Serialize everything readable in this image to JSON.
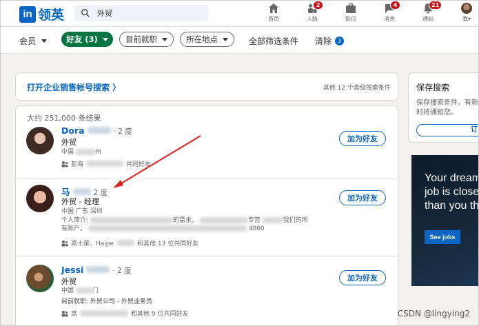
{
  "brand": {
    "logo_mark": "in",
    "name": "领英"
  },
  "search": {
    "value": "外贸"
  },
  "nav": [
    {
      "label": "首页",
      "icon": "home-icon",
      "badge": ""
    },
    {
      "label": "人脉",
      "icon": "network-icon",
      "badge": "2"
    },
    {
      "label": "职位",
      "icon": "jobs-icon",
      "badge": ""
    },
    {
      "label": "消息",
      "icon": "messaging-icon",
      "badge": "4"
    },
    {
      "label": "通知",
      "icon": "notifications-icon",
      "badge": "21"
    },
    {
      "label": "我",
      "icon": "me-avatar",
      "badge": ""
    }
  ],
  "filters": {
    "member": "会员",
    "friends": "好友 (3)",
    "company": "目前就职",
    "location": "所在地点",
    "all": "全部筛选条件",
    "clear": "清除",
    "clear_count": "3"
  },
  "sales": {
    "link": "打开企业销售帐号搜索 〉",
    "other": "其他 12 个高级搜索条件"
  },
  "results": {
    "count": "大约 251,000 条结果",
    "people": [
      {
        "name": "Dora",
        "degree": "· 2 度",
        "title": "外贸",
        "location_prefix": "中国",
        "location_suffix": "州",
        "meta": "",
        "summary": "",
        "connections_prefix": "彭海",
        "connections_suffix": "共同好友",
        "button": "加为好友"
      },
      {
        "name": "马",
        "degree": "2 度",
        "title": "外贸 - 经理",
        "location": "中国 广东 深圳",
        "summary_prefix": "个人简介:",
        "summary_mid": "的需求，",
        "summary_mid2": "专营",
        "summary_end": "我们的所",
        "summary_line2_prefix": "有账户，",
        "summary_line2_suffix": "4800",
        "connections_prefix": "高士梁、Haipe",
        "connections_suffix": "和其他 13 位共同好友",
        "button": "加为好友"
      },
      {
        "name": "Jessi",
        "degree": "· 2 度",
        "title": "外贸",
        "location_prefix": "中国",
        "location_suffix": "门",
        "meta": "目前就职: 外贸公司 - 外贸业务员",
        "connections_prefix": "高",
        "connections_suffix": "和其他 9 位共同好友",
        "button": "加为好友"
      }
    ]
  },
  "saved_search": {
    "title": "保存搜索",
    "desc": "保存搜索条件，有新结果时将通知您。",
    "button": "订"
  },
  "ad": {
    "text": "Your dream job is closer than you think",
    "button": "See jobs"
  },
  "watermark": "CSDN @lingying2",
  "colors": {
    "brand_blue": "#0a66c2",
    "friends_green": "#057642",
    "badge_red": "#cc1016",
    "annotation_red": "#e0201c"
  }
}
